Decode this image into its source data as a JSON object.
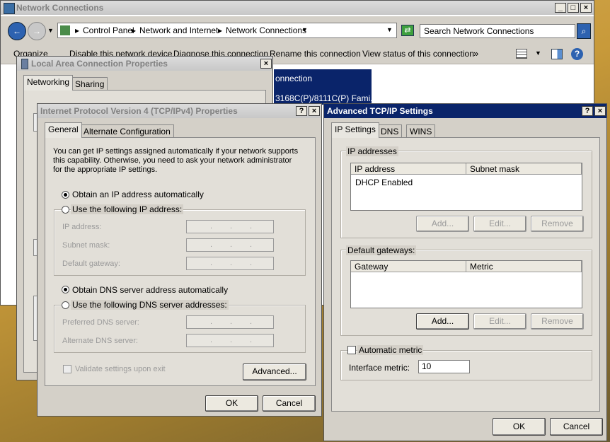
{
  "explorer": {
    "title": "Network Connections",
    "breadcrumb": [
      "Control Panel",
      "Network and Internet",
      "Network Connections"
    ],
    "search_placeholder": "Search Network Connections",
    "toolbar": [
      "Organize",
      "Disable this network device",
      "Diagnose this connection",
      "Rename this connection",
      "View status of this connection"
    ],
    "more": "»",
    "selected_item_line1": "onnection",
    "selected_item_line2": "3168C(P)/8111C(P) Fami..."
  },
  "lac_props": {
    "title": "Local Area Connection Properties",
    "tabs": [
      "Networking",
      "Sharing"
    ]
  },
  "ipv4": {
    "title": "Internet Protocol Version 4 (TCP/IPv4) Properties",
    "tabs": [
      "General",
      "Alternate Configuration"
    ],
    "intro": "You can get IP settings assigned automatically if your network supports this capability. Otherwise, you need to ask your network administrator for the appropriate IP settings.",
    "obtain_ip": "Obtain an IP address automatically",
    "use_ip": "Use the following IP address:",
    "ip_address": "IP address:",
    "subnet_mask": "Subnet mask:",
    "default_gateway": "Default gateway:",
    "obtain_dns": "Obtain DNS server address automatically",
    "use_dns": "Use the following DNS server addresses:",
    "preferred_dns": "Preferred DNS server:",
    "alternate_dns": "Alternate DNS server:",
    "validate": "Validate settings upon exit",
    "advanced": "Advanced...",
    "ok": "OK",
    "cancel": "Cancel"
  },
  "advanced": {
    "title": "Advanced TCP/IP Settings",
    "tabs": [
      "IP Settings",
      "DNS",
      "WINS"
    ],
    "ip_group": "IP addresses",
    "ip_cols": [
      "IP address",
      "Subnet mask"
    ],
    "ip_rows": [
      "DHCP Enabled"
    ],
    "gw_group": "Default gateways:",
    "gw_cols": [
      "Gateway",
      "Metric"
    ],
    "add": "Add...",
    "edit": "Edit...",
    "remove": "Remove",
    "auto_metric": "Automatic metric",
    "interface_metric": "Interface metric:",
    "interface_metric_value": "10",
    "ok": "OK",
    "cancel": "Cancel"
  }
}
